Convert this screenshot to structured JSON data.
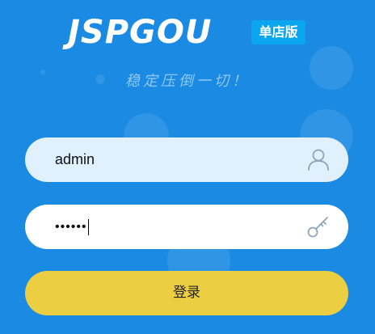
{
  "brand": {
    "logo_text": "JSPGOU",
    "edition_badge": "单店版",
    "slogan": "稳定压倒一切！"
  },
  "login_form": {
    "username": {
      "value": "admin",
      "icon": "user-icon"
    },
    "password": {
      "masked_value": "••••••",
      "icon": "key-icon"
    },
    "submit_label": "登录"
  },
  "colors": {
    "background": "#1a8ae3",
    "badge": "#0aa6f0",
    "username_field": "#e0f0fc",
    "password_field": "#ffffff",
    "submit_button": "#ecce43",
    "icon_stroke": "#8fa4b8"
  }
}
